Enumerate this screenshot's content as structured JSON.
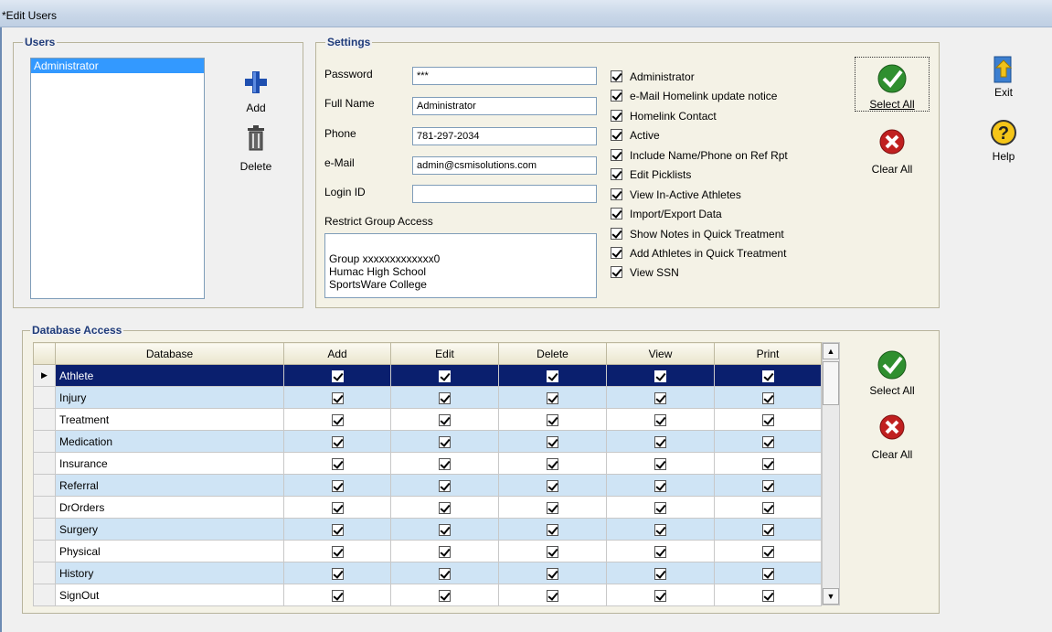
{
  "window": {
    "title": "*Edit Users"
  },
  "users": {
    "legend": "Users",
    "items": [
      "Administrator"
    ],
    "add_label": "Add",
    "delete_label": "Delete"
  },
  "settings": {
    "legend": "Settings",
    "password_label": "Password",
    "password_value": "***",
    "fullname_label": "Full Name",
    "fullname_value": "Administrator",
    "phone_label": "Phone",
    "phone_value": "781-297-2034",
    "email_label": "e-Mail",
    "email_value": "admin@csmisolutions.com",
    "loginid_label": "Login ID",
    "loginid_value": "",
    "restrict_label": "Restrict Group Access",
    "groups": [
      "Group xxxxxxxxxxxxx0",
      "Humac High School",
      "SportsWare College"
    ],
    "checkboxes": [
      "Administrator",
      "e-Mail Homelink update notice",
      "Homelink Contact",
      "Active",
      "Include Name/Phone on Ref Rpt",
      "Edit Picklists",
      "View In-Active Athletes",
      "Import/Export Data",
      "Show Notes in Quick Treatment",
      "Add Athletes in Quick Treatment",
      "View SSN"
    ],
    "select_all_label": "Select All",
    "clear_all_label": "Clear All"
  },
  "side": {
    "exit_label": "Exit",
    "help_label": "Help"
  },
  "db": {
    "legend": "Database Access",
    "columns": [
      "Database",
      "Add",
      "Edit",
      "Delete",
      "View",
      "Print"
    ],
    "rows": [
      "Athlete",
      "Injury",
      "Treatment",
      "Medication",
      "Insurance",
      "Referral",
      "DrOrders",
      "Surgery",
      "Physical",
      "History",
      "SignOut"
    ],
    "select_all_label": "Select All",
    "clear_all_label": "Clear All"
  },
  "colors": {
    "selected_row": "#0a1f6e",
    "alt_row": "#cfe4f5",
    "list_selection": "#3399ff",
    "legend_text": "#1f3b7a"
  }
}
